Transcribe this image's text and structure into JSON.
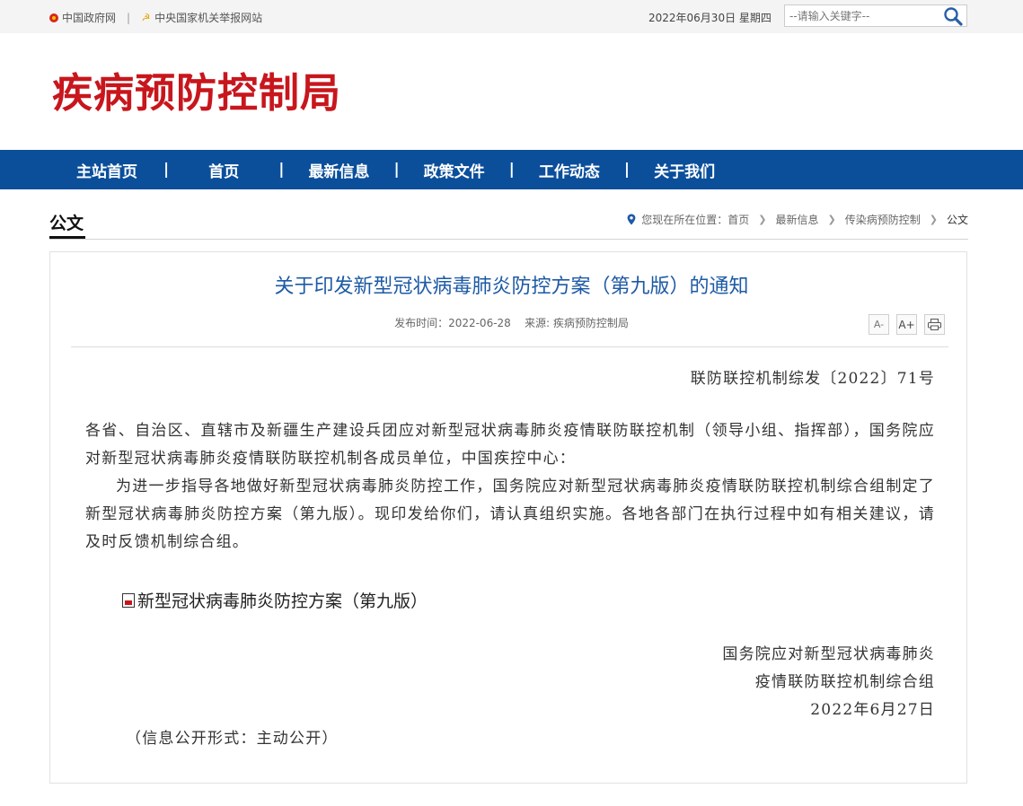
{
  "top": {
    "links": [
      "中国政府网",
      "中央国家机关举报网站"
    ],
    "separator": "|",
    "date": "2022年06月30日 星期四",
    "search_placeholder": "--请输入关键字--"
  },
  "logo": "疾病预防控制局",
  "nav": {
    "items": [
      "主站首页",
      "首页",
      "最新信息",
      "政策文件",
      "工作动态",
      "关于我们"
    ],
    "divider": "|"
  },
  "section": {
    "title": "公文",
    "breadcrumb_prefix": "您现在所在位置：",
    "breadcrumb": [
      "首页",
      "最新信息",
      "传染病预防控制",
      "公文"
    ]
  },
  "article": {
    "title": "关于印发新型冠状病毒肺炎防控方案（第九版）的通知",
    "meta": "发布时间：2022-06-28    来源: 疾病预防控制局",
    "tools": [
      "A-",
      "A+",
      "print-icon"
    ],
    "doc_number": "联防联控机制综发〔2022〕71号",
    "paragraph1": "各省、自治区、直辖市及新疆生产建设兵团应对新型冠状病毒肺炎疫情联防联控机制（领导小组、指挥部），国务院应对新型冠状病毒肺炎疫情联防联控机制各成员单位，中国疾控中心：",
    "paragraph2": "为进一步指导各地做好新型冠状病毒肺炎防控工作，国务院应对新型冠状病毒肺炎疫情联防联控机制综合组制定了新型冠状病毒肺炎防控方案（第九版）。现印发给你们，请认真组织实施。各地各部门在执行过程中如有相关建议，请及时反馈机制综合组。",
    "attachment": "新型冠状病毒肺炎防控方案（第九版）",
    "signature_line1": "国务院应对新型冠状病毒肺炎",
    "signature_line2": "疫情联防联控机制综合组",
    "signature_date": "2022年6月27日",
    "disclosure": "（信息公开形式：主动公开）"
  },
  "colors": {
    "nav_bg": "#0b4f9b",
    "logo_red": "#c8161d",
    "title_blue": "#1d5aa5"
  }
}
